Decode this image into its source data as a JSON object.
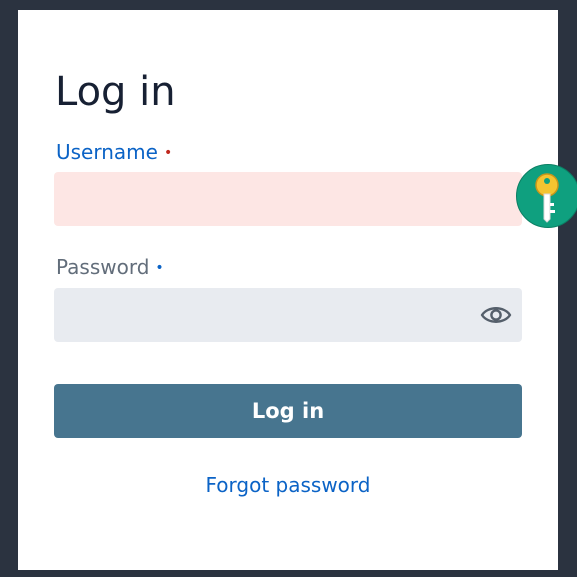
{
  "form": {
    "title": "Log in",
    "username": {
      "label": "Username",
      "required_marker": "•",
      "value": "",
      "placeholder": ""
    },
    "password": {
      "label": "Password",
      "required_marker": "•",
      "value": "",
      "placeholder": ""
    },
    "submit_label": "Log in",
    "forgot_label": "Forgot password"
  },
  "icons": {
    "password_toggle": "eye-icon",
    "password_manager": "key-icon"
  },
  "colors": {
    "accent": "#0b63c6",
    "error_bg": "#fde6e4",
    "error_marker": "#c0281e",
    "button_bg": "#47758f",
    "badge_bg": "#0fa07f",
    "key_color": "#f4c430"
  }
}
